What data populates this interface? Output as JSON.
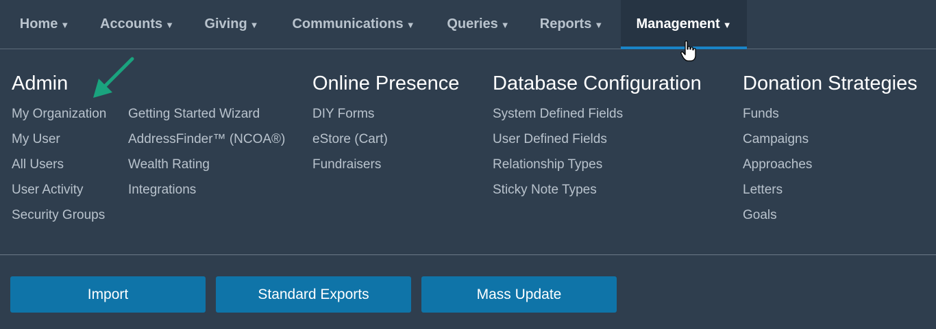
{
  "nav": {
    "items": [
      {
        "label": "Home"
      },
      {
        "label": "Accounts"
      },
      {
        "label": "Giving"
      },
      {
        "label": "Communications"
      },
      {
        "label": "Queries"
      },
      {
        "label": "Reports"
      },
      {
        "label": "Management"
      }
    ],
    "active_index": 6
  },
  "menu": {
    "admin": {
      "title": "Admin",
      "col1": [
        "My Organization",
        "My User",
        "All Users",
        "User Activity",
        "Security Groups"
      ],
      "col2": [
        "Getting Started Wizard",
        "AddressFinder™ (NCOA®)",
        "Wealth Rating",
        "Integrations"
      ]
    },
    "online_presence": {
      "title": "Online Presence",
      "links": [
        "DIY Forms",
        "eStore (Cart)",
        "Fundraisers"
      ]
    },
    "database_configuration": {
      "title": "Database Configuration",
      "links": [
        "System Defined Fields",
        "User Defined Fields",
        "Relationship Types",
        "Sticky Note Types"
      ]
    },
    "donation_strategies": {
      "title": "Donation Strategies",
      "links": [
        "Funds",
        "Campaigns",
        "Approaches",
        "Letters",
        "Goals"
      ]
    }
  },
  "buttons": {
    "import": "Import",
    "standard_exports": "Standard Exports",
    "mass_update": "Mass Update"
  },
  "colors": {
    "background": "#2f3e4e",
    "active_tab": "#263443",
    "accent": "#1a84c6",
    "button": "#0f74a8",
    "annotation_arrow": "#1aa37e"
  }
}
